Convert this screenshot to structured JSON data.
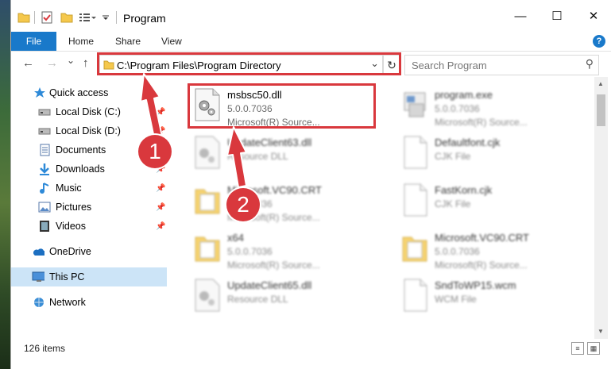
{
  "window": {
    "title": "Program",
    "minimize": "—",
    "maximize": "☐",
    "close": "✕"
  },
  "ribbon": {
    "tabs": [
      "File",
      "Home",
      "Share",
      "View"
    ],
    "help": "?"
  },
  "nav": {
    "back": "←",
    "forward": "→",
    "dropdown": "⌄",
    "up": "↑",
    "address": "C:\\Program Files\\Program Directory",
    "address_dropdown": "⌄",
    "refresh": "↻",
    "search_placeholder": "Search Program",
    "search_icon": "⚲"
  },
  "sidebar": {
    "items": [
      {
        "label": "Quick access",
        "icon": "star-icon",
        "pinned": false
      },
      {
        "label": "Local Disk (C:)",
        "icon": "drive-icon",
        "pinned": true
      },
      {
        "label": "Local Disk (D:)",
        "icon": "drive-icon",
        "pinned": true
      },
      {
        "label": "Documents",
        "icon": "documents-icon",
        "pinned": true
      },
      {
        "label": "Downloads",
        "icon": "downloads-icon",
        "pinned": true
      },
      {
        "label": "Music",
        "icon": "music-icon",
        "pinned": true
      },
      {
        "label": "Pictures",
        "icon": "pictures-icon",
        "pinned": true
      },
      {
        "label": "Videos",
        "icon": "videos-icon",
        "pinned": true
      },
      {
        "label": "OneDrive",
        "icon": "onedrive-icon",
        "pinned": false
      },
      {
        "label": "This PC",
        "icon": "pc-icon",
        "pinned": false,
        "selected": true
      },
      {
        "label": "Network",
        "icon": "network-icon",
        "pinned": false
      }
    ]
  },
  "files": [
    {
      "name": "msbsc50.dll",
      "line2": "5.0.0.7036",
      "line3": "Microsoft(R) Source...",
      "icon": "dll-icon",
      "highlighted": true
    },
    {
      "name": "program.exe",
      "line2": "5.0.0.7036",
      "line3": "Microsoft(R) Source...",
      "icon": "exe-icon"
    },
    {
      "name": "UpdateClient63.dll",
      "line2": "Resource DLL",
      "line3": "",
      "icon": "dll-icon"
    },
    {
      "name": "Defaultfont.cjk",
      "line2": "CJK File",
      "line3": "",
      "icon": "file-icon"
    },
    {
      "name": "Microsoft.VC90.CRT",
      "line2": "5.0.0.7036",
      "line3": "Microsoft(R) Source...",
      "icon": "folder-icon"
    },
    {
      "name": "FastKorn.cjk",
      "line2": "CJK File",
      "line3": "",
      "icon": "file-icon"
    },
    {
      "name": "x64",
      "line2": "5.0.0.7036",
      "line3": "Microsoft(R) Source...",
      "icon": "folder-icon"
    },
    {
      "name": "Microsoft.VC90.CRT",
      "line2": "5.0.0.7036",
      "line3": "Microsoft(R) Source...",
      "icon": "folder-icon"
    },
    {
      "name": "UpdateClient65.dll",
      "line2": "Resource DLL",
      "line3": "",
      "icon": "dll-icon"
    },
    {
      "name": "SndToWP15.wcm",
      "line2": "WCM File",
      "line3": "",
      "icon": "file-icon"
    }
  ],
  "status": {
    "count": "126 items"
  },
  "callouts": {
    "first": "1",
    "second": "2"
  },
  "colors": {
    "accent": "#1979ca",
    "callout": "#d9383d",
    "selection": "#cce4f7"
  }
}
